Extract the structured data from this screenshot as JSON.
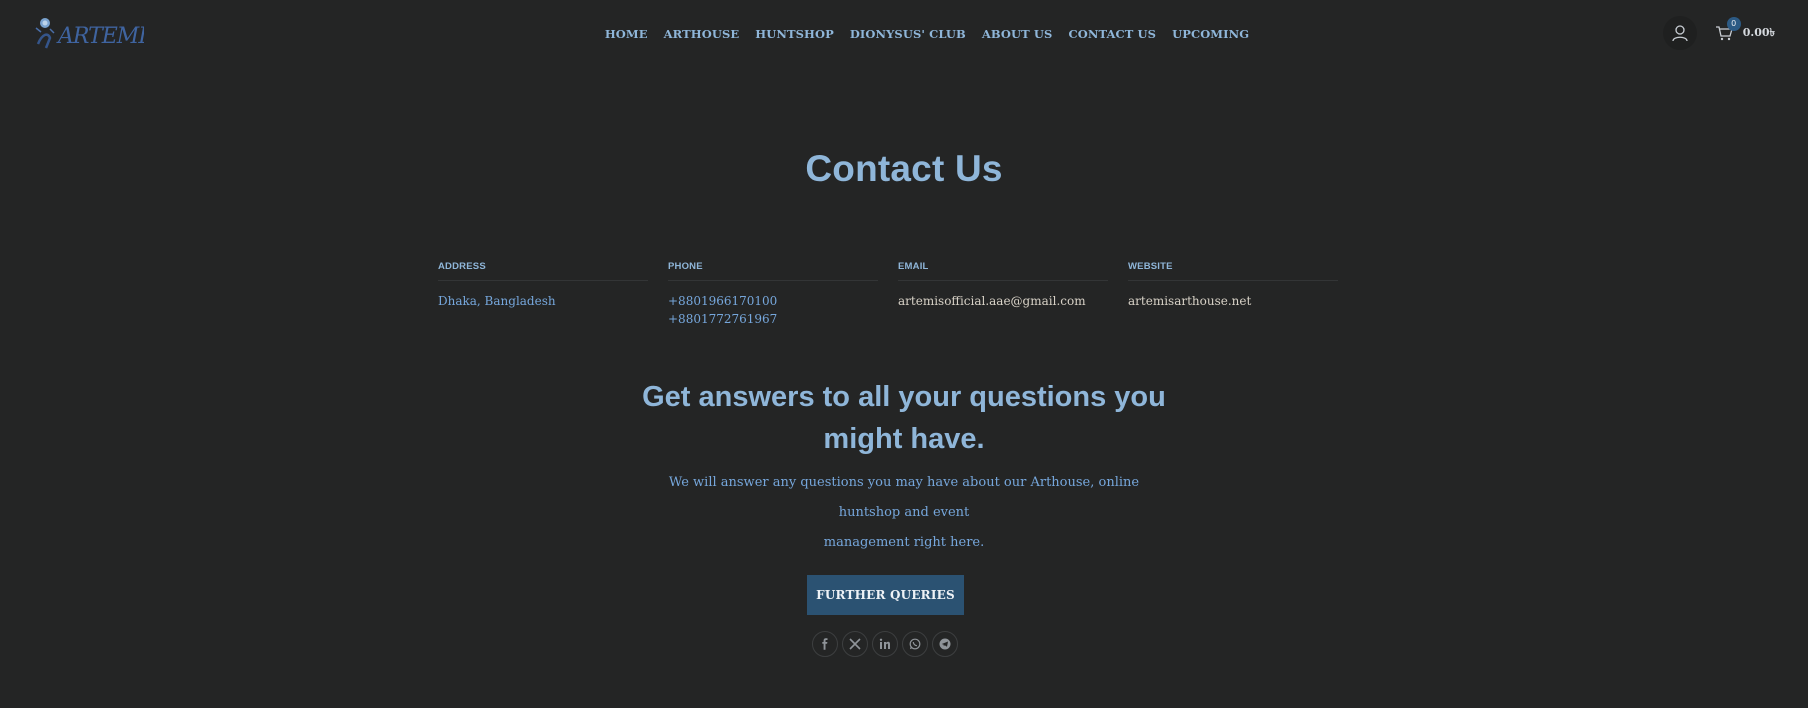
{
  "header": {
    "logo_text": "ARTEMIS",
    "nav": [
      "HOME",
      "ARTHOUSE",
      "HUNTSHOP",
      "DIONYSUS' CLUB",
      "ABOUT US",
      "CONTACT US",
      "UPCOMING"
    ],
    "cart_count": "0",
    "cart_total": "0.00৳"
  },
  "page_title": "Contact Us",
  "contact": {
    "address": {
      "label": "ADDRESS",
      "value": "Dhaka, Bangladesh"
    },
    "phone": {
      "label": "PHONE",
      "values": [
        "+8801966170100",
        "+8801772761967"
      ]
    },
    "email": {
      "label": "EMAIL",
      "value": "artemisofficial.aae@gmail.com"
    },
    "website": {
      "label": "WEBSITE",
      "value": "artemisarthouse.net"
    }
  },
  "answers": {
    "title_line1": "Get answers to all your questions you",
    "title_line2": "might have.",
    "text_line1": "We will answer any questions you may have about our Arthouse, online",
    "text_line2": "huntshop and event",
    "text_line3": "management right here.",
    "button": "FURTHER QUERIES"
  },
  "socials": [
    "facebook-icon",
    "x-icon",
    "linkedin-icon",
    "whatsapp-icon",
    "telegram-icon"
  ],
  "colors": {
    "background": "#242525",
    "accent": "#8fb6d9",
    "link": "#76a7dc",
    "button": "#2b5272"
  }
}
